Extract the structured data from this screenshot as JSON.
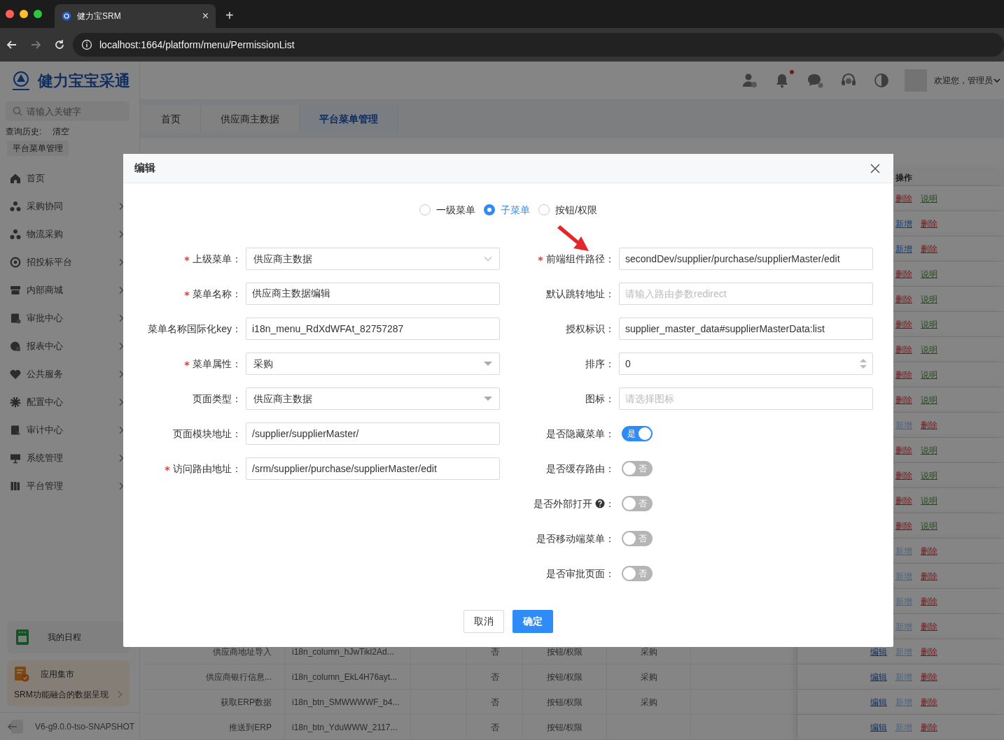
{
  "browser": {
    "tab_title": "健力宝SRM",
    "tab_close": "×",
    "new_tab": "+",
    "url": "localhost:1664/platform/menu/PermissionList"
  },
  "sidebar": {
    "brand": "健力宝宝采通",
    "search_placeholder": "请输入关键字",
    "history_label": "查询历史:",
    "history_clear": "清空",
    "history_tags": [
      "平台菜单管理"
    ],
    "menu": [
      {
        "label": "首页",
        "expandable": false
      },
      {
        "label": "采购协同",
        "expandable": true
      },
      {
        "label": "物流采购",
        "expandable": true
      },
      {
        "label": "招投标平台",
        "expandable": true
      },
      {
        "label": "内部商城",
        "expandable": true
      },
      {
        "label": "审批中心",
        "expandable": true
      },
      {
        "label": "报表中心",
        "expandable": true
      },
      {
        "label": "公共服务",
        "expandable": true
      },
      {
        "label": "配置中心",
        "expandable": true
      },
      {
        "label": "审计中心",
        "expandable": true
      },
      {
        "label": "系统管理",
        "expandable": true
      },
      {
        "label": "平台管理",
        "expandable": true
      }
    ],
    "schedule": "我的日程",
    "market": {
      "title": "应用集市",
      "desc": "SRM功能融合的数据呈现"
    },
    "version": "V6-g9.0.0-tso-SNAPSHOT"
  },
  "header": {
    "unread": true,
    "welcome": "欢迎您，管理员"
  },
  "tabs": [
    {
      "label": "首页",
      "selected": false
    },
    {
      "label": "供应商主数据",
      "selected": false
    },
    {
      "label": "平台菜单管理",
      "selected": true
    }
  ],
  "table": {
    "ops_header": "操作",
    "rows": [
      {
        "actions": [
          {
            "label": "删除",
            "kind": "delete",
            "disabled": false
          },
          {
            "label": "说明",
            "kind": "note",
            "disabled": false
          }
        ]
      },
      {
        "actions": [
          {
            "label": "新增",
            "kind": "add",
            "disabled": false
          },
          {
            "label": "删除",
            "kind": "delete",
            "disabled": false
          }
        ]
      },
      {
        "actions": [
          {
            "label": "新增",
            "kind": "add",
            "disabled": false
          },
          {
            "label": "删除",
            "kind": "delete",
            "disabled": false
          }
        ]
      },
      {
        "actions": [
          {
            "label": "删除",
            "kind": "delete",
            "disabled": false
          },
          {
            "label": "说明",
            "kind": "note",
            "disabled": false
          }
        ]
      },
      {
        "actions": [
          {
            "label": "删除",
            "kind": "delete",
            "disabled": false
          },
          {
            "label": "说明",
            "kind": "note",
            "disabled": false
          }
        ]
      },
      {
        "actions": [
          {
            "label": "删除",
            "kind": "delete",
            "disabled": false
          },
          {
            "label": "说明",
            "kind": "note",
            "disabled": false
          }
        ]
      },
      {
        "actions": [
          {
            "label": "删除",
            "kind": "delete",
            "disabled": false
          },
          {
            "label": "说明",
            "kind": "note",
            "disabled": false
          }
        ]
      },
      {
        "actions": [
          {
            "label": "删除",
            "kind": "delete",
            "disabled": false
          },
          {
            "label": "说明",
            "kind": "note",
            "disabled": false
          }
        ]
      },
      {
        "actions": [
          {
            "label": "删除",
            "kind": "delete",
            "disabled": false
          },
          {
            "label": "说明",
            "kind": "note",
            "disabled": false
          }
        ]
      },
      {
        "actions": [
          {
            "label": "新增",
            "kind": "add",
            "disabled": true
          },
          {
            "label": "删除",
            "kind": "delete",
            "disabled": false
          }
        ]
      },
      {
        "actions": [
          {
            "label": "删除",
            "kind": "delete",
            "disabled": false
          },
          {
            "label": "说明",
            "kind": "note",
            "disabled": false
          }
        ]
      },
      {
        "actions": [
          {
            "label": "删除",
            "kind": "delete",
            "disabled": false
          },
          {
            "label": "说明",
            "kind": "note",
            "disabled": false
          }
        ]
      },
      {
        "actions": [
          {
            "label": "删除",
            "kind": "delete",
            "disabled": false
          },
          {
            "label": "说明",
            "kind": "note",
            "disabled": false
          }
        ]
      },
      {
        "actions": [
          {
            "label": "删除",
            "kind": "delete",
            "disabled": false
          },
          {
            "label": "说明",
            "kind": "note",
            "disabled": false
          }
        ]
      },
      {
        "actions": [
          {
            "label": "新增",
            "kind": "add",
            "disabled": true
          },
          {
            "label": "删除",
            "kind": "delete",
            "disabled": false
          }
        ]
      },
      {
        "actions": [
          {
            "label": "新增",
            "kind": "add",
            "disabled": true
          },
          {
            "label": "删除",
            "kind": "delete",
            "disabled": false
          }
        ]
      },
      {
        "actions": [
          {
            "label": "新增",
            "kind": "add",
            "disabled": true
          },
          {
            "label": "删除",
            "kind": "delete",
            "disabled": false
          }
        ]
      },
      {
        "actions": [
          {
            "label": "新增",
            "kind": "add",
            "disabled": true
          },
          {
            "label": "删除",
            "kind": "delete",
            "disabled": false
          }
        ]
      },
      {
        "column_1": "供应商地址导入",
        "column_2": "i18n_column_hJwTikl2Ad...",
        "column_4": "否",
        "column_5": "按钮/权限",
        "column_6": "采购",
        "actions": [
          {
            "label": "编辑",
            "kind": "edit",
            "disabled": false
          },
          {
            "label": "新增",
            "kind": "add",
            "disabled": true
          },
          {
            "label": "删除",
            "kind": "delete",
            "disabled": false
          }
        ]
      },
      {
        "column_1": "供应商银行信息...",
        "column_2": "i18n_column_EkL4H76ayt...",
        "column_4": "否",
        "column_5": "按钮/权限",
        "column_6": "采购",
        "actions": [
          {
            "label": "编辑",
            "kind": "edit",
            "disabled": false
          },
          {
            "label": "新增",
            "kind": "add",
            "disabled": true
          },
          {
            "label": "删除",
            "kind": "delete",
            "disabled": false
          }
        ]
      },
      {
        "column_1": "获取ERP数据",
        "column_2": "i18n_btn_SMWWWWF_b4...",
        "column_4": "否",
        "column_5": "按钮/权限",
        "column_6": "采购",
        "actions": [
          {
            "label": "编辑",
            "kind": "edit",
            "disabled": false
          },
          {
            "label": "新增",
            "kind": "add",
            "disabled": true
          },
          {
            "label": "删除",
            "kind": "delete",
            "disabled": false
          }
        ]
      },
      {
        "column_1": "推送到ERP",
        "column_2": "i18n_btn_YduWWW_2117...",
        "column_4": "否",
        "column_5": "按钮/权限",
        "actions": [
          {
            "label": "编辑",
            "kind": "edit",
            "disabled": false
          },
          {
            "label": "新增",
            "kind": "add",
            "disabled": true
          },
          {
            "label": "删除",
            "kind": "delete",
            "disabled": false
          }
        ]
      }
    ]
  },
  "dialog": {
    "title": "编辑",
    "menu_type": [
      {
        "label": "一级菜单",
        "selected": false
      },
      {
        "label": "子菜单",
        "selected": true
      },
      {
        "label": "按钮/权限",
        "selected": false
      }
    ],
    "fields_left": [
      {
        "label": "上级菜单",
        "colon": "：",
        "required": true,
        "kind": "select",
        "value": "供应商主数据"
      },
      {
        "label": "菜单名称",
        "colon": "：",
        "required": true,
        "kind": "input",
        "value": "供应商主数据编辑"
      },
      {
        "label": "菜单名称国际化key",
        "colon": "：",
        "required": false,
        "kind": "input",
        "value": "i18n_menu_RdXdWFAt_82757287"
      },
      {
        "label": "菜单属性",
        "colon": "：",
        "required": true,
        "kind": "dropdown",
        "value": "采购"
      },
      {
        "label": "页面类型",
        "colon": "：",
        "required": false,
        "kind": "dropdown",
        "value": "供应商主数据"
      },
      {
        "label": "页面模块地址",
        "colon": "：",
        "required": false,
        "kind": "input",
        "value": "/supplier/supplierMaster/"
      },
      {
        "label": "访问路由地址",
        "colon": "：",
        "required": true,
        "kind": "input",
        "value": "/srm/supplier/purchase/supplierMaster/edit"
      }
    ],
    "fields_right": [
      {
        "label": "前端组件路径",
        "colon": "：",
        "required": true,
        "kind": "input",
        "value": "secondDev/supplier/purchase/supplierMaster/edit"
      },
      {
        "label": "默认跳转地址",
        "colon": "：",
        "required": false,
        "kind": "input",
        "placeholder": "请输入路由参数redirect"
      },
      {
        "label": "授权标识",
        "colon": "：",
        "required": false,
        "kind": "input",
        "value": "supplier_master_data#supplierMasterData:list"
      },
      {
        "label": "排序",
        "colon": "：",
        "required": false,
        "kind": "number",
        "value": "0"
      },
      {
        "label": "图标",
        "colon": "：",
        "required": false,
        "kind": "input",
        "placeholder": "请选择图标"
      },
      {
        "label": "是否隐藏菜单",
        "colon": "：",
        "required": false,
        "kind": "switch",
        "on": true,
        "text": "是"
      },
      {
        "label": "是否缓存路由",
        "colon": "：",
        "required": false,
        "kind": "switch",
        "on": false,
        "text": "否"
      },
      {
        "label": "是否外部打开",
        "colon": "：",
        "required": false,
        "kind": "switch",
        "help": true,
        "on": false,
        "text": "否"
      },
      {
        "label": "是否移动端菜单",
        "colon": "：",
        "required": false,
        "kind": "switch",
        "on": false,
        "text": "否"
      },
      {
        "label": "是否审批页面",
        "colon": "：",
        "required": false,
        "kind": "switch",
        "on": false,
        "text": "否"
      }
    ],
    "cancel": "取消",
    "confirm": "确定"
  }
}
